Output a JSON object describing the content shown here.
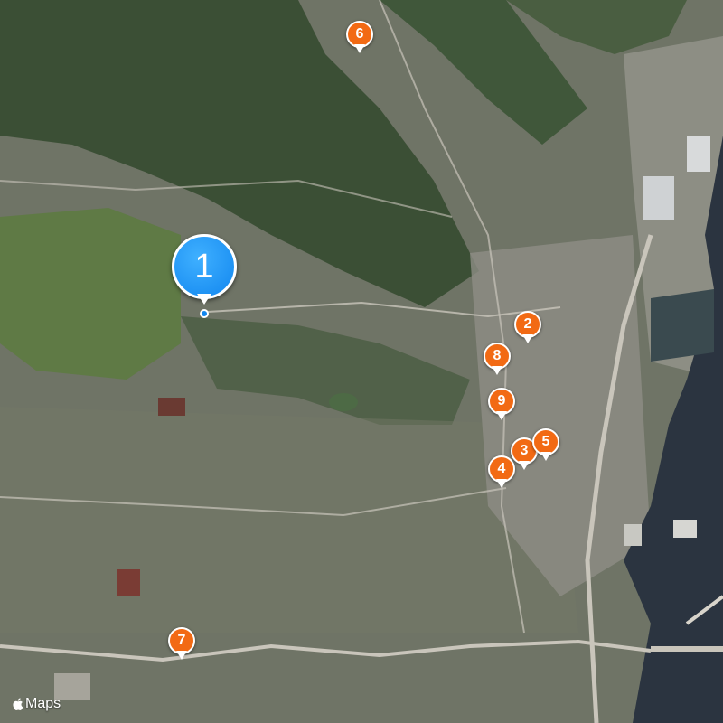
{
  "map": {
    "style": "satellite",
    "colors": {
      "vegetation": "#2f4a2a",
      "urban": "#8a8a84",
      "water": "#2b3440",
      "road": "#c9c5bb"
    }
  },
  "pins": [
    {
      "label": "1",
      "kind": "primary",
      "color": "#1186ef"
    },
    {
      "label": "2",
      "kind": "secondary",
      "color": "#f26a14"
    },
    {
      "label": "3",
      "kind": "secondary",
      "color": "#f26a14"
    },
    {
      "label": "4",
      "kind": "secondary",
      "color": "#f26a14"
    },
    {
      "label": "5",
      "kind": "secondary",
      "color": "#f26a14"
    },
    {
      "label": "6",
      "kind": "secondary",
      "color": "#f26a14"
    },
    {
      "label": "7",
      "kind": "secondary",
      "color": "#f26a14"
    },
    {
      "label": "8",
      "kind": "secondary",
      "color": "#f26a14"
    },
    {
      "label": "9",
      "kind": "secondary",
      "color": "#f26a14"
    }
  ],
  "attribution": {
    "icon": "apple-logo-icon",
    "text": "Maps"
  }
}
